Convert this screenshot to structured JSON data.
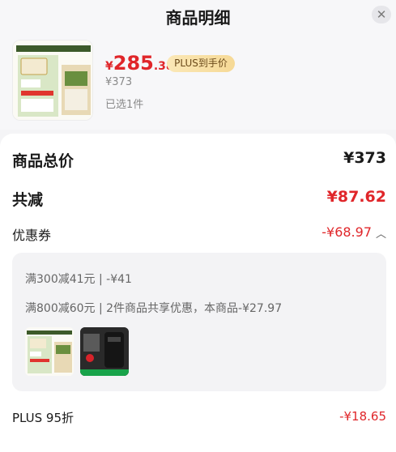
{
  "header": {
    "title": "商品明细",
    "close_icon": "close-icon"
  },
  "product": {
    "price_symbol": "¥",
    "price_int": "285",
    "price_dec": ".38",
    "plus_tag": "PLUS到手价",
    "original_price": "¥373",
    "selected_count": "已选1件",
    "image_icon": "product-thumbnail"
  },
  "summary": {
    "total_label": "商品总价",
    "total_value": "¥373",
    "discount_label": "共减",
    "discount_value": "¥87.62",
    "coupon_label": "优惠券",
    "coupon_value": "-¥68.97",
    "coupon_expanded_icon": "chevron-up-icon"
  },
  "coupon_details": {
    "rule1": "满300减41元 | -¥41",
    "rule2": "满800减60元 | 2件商品共享优惠，本商品-¥27.97",
    "items": [
      "pet-food-bag",
      "backpack"
    ]
  },
  "plus": {
    "label": "PLUS 95折",
    "value": "-¥18.65"
  },
  "colors": {
    "accent_red": "#e0262a",
    "plus_gold": "#f6d996"
  }
}
